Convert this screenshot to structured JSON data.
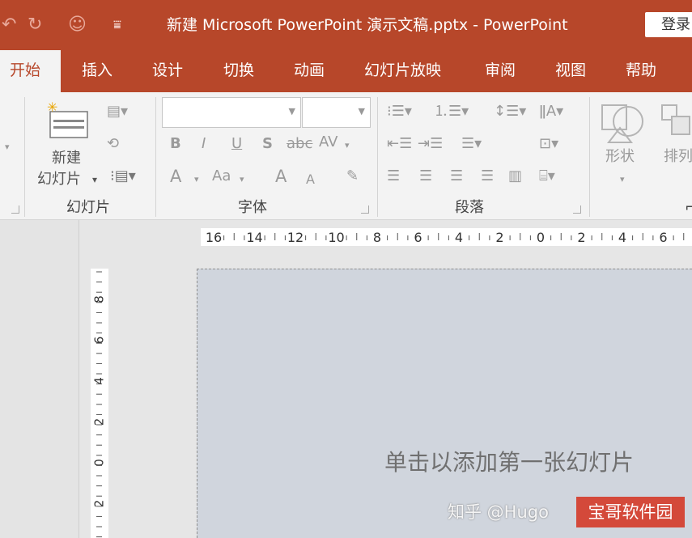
{
  "titlebar": {
    "title": "新建 Microsoft PowerPoint 演示文稿.pptx  -  PowerPoint",
    "login_label": "登录",
    "icons": [
      "undo-icon",
      "redo-icon",
      "presenter-icon",
      "customize-quick-access-icon"
    ]
  },
  "tabs": [
    {
      "label": "开始",
      "active": true
    },
    {
      "label": "插入"
    },
    {
      "label": "设计"
    },
    {
      "label": "切换"
    },
    {
      "label": "动画"
    },
    {
      "label": "幻灯片放映"
    },
    {
      "label": "审阅"
    },
    {
      "label": "视图"
    },
    {
      "label": "帮助"
    }
  ],
  "ribbon": {
    "slides_group": {
      "new_slide_line1": "新建",
      "new_slide_line2": "幻灯片",
      "label": "幻灯片"
    },
    "font_group": {
      "label": "字体",
      "font_name_value": "",
      "font_size_value": "",
      "bold": "B",
      "italic": "I",
      "underline": "U",
      "shadow": "S",
      "strikethrough": "abc",
      "char_spacing": "AV",
      "font_color": "A",
      "change_case": "Aa",
      "grow_font": "A",
      "shrink_font": "A"
    },
    "paragraph_group": {
      "label": "段落"
    },
    "drawing_group": {
      "shapes_label": "形状",
      "arrange_label": "排列"
    }
  },
  "rulers": {
    "horizontal_labels": [
      "16",
      "14",
      "12",
      "10",
      "8",
      "6",
      "4",
      "2",
      "0",
      "2",
      "4",
      "6"
    ],
    "vertical_labels": [
      "8",
      "6",
      "4",
      "2",
      "0",
      "2"
    ]
  },
  "slide": {
    "placeholder_text": "单击以添加第一张幻灯片"
  },
  "watermark": {
    "text": "知乎 @Hugo",
    "badge": "宝哥软件园"
  },
  "colors": {
    "accent": "#b7472a",
    "ribbon_bg": "#f3f3f3",
    "slide_bg": "#d0d5dd"
  }
}
